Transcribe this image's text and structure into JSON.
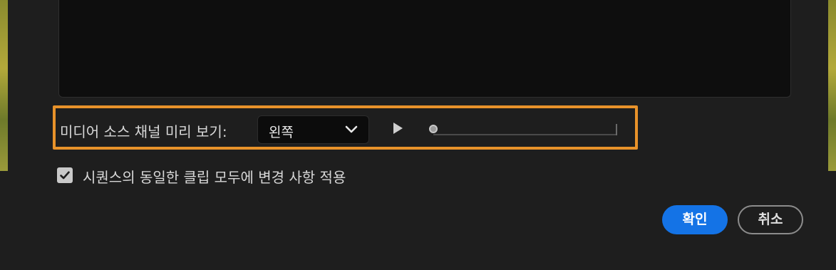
{
  "preview": {},
  "channel_preview": {
    "label": "미디어 소스 채널 미리 보기:",
    "selected": "왼쪽",
    "slider_position": 0
  },
  "apply_all": {
    "label": "시퀀스의 동일한 클립 모두에 변경 사항 적용",
    "checked": true
  },
  "buttons": {
    "ok": "확인",
    "cancel": "취소"
  },
  "colors": {
    "accent": "#1473e6",
    "highlight": "#e8922a"
  },
  "icons": {
    "dropdown": "chevron-down-icon",
    "play": "play-icon",
    "check": "checkmark-icon"
  }
}
